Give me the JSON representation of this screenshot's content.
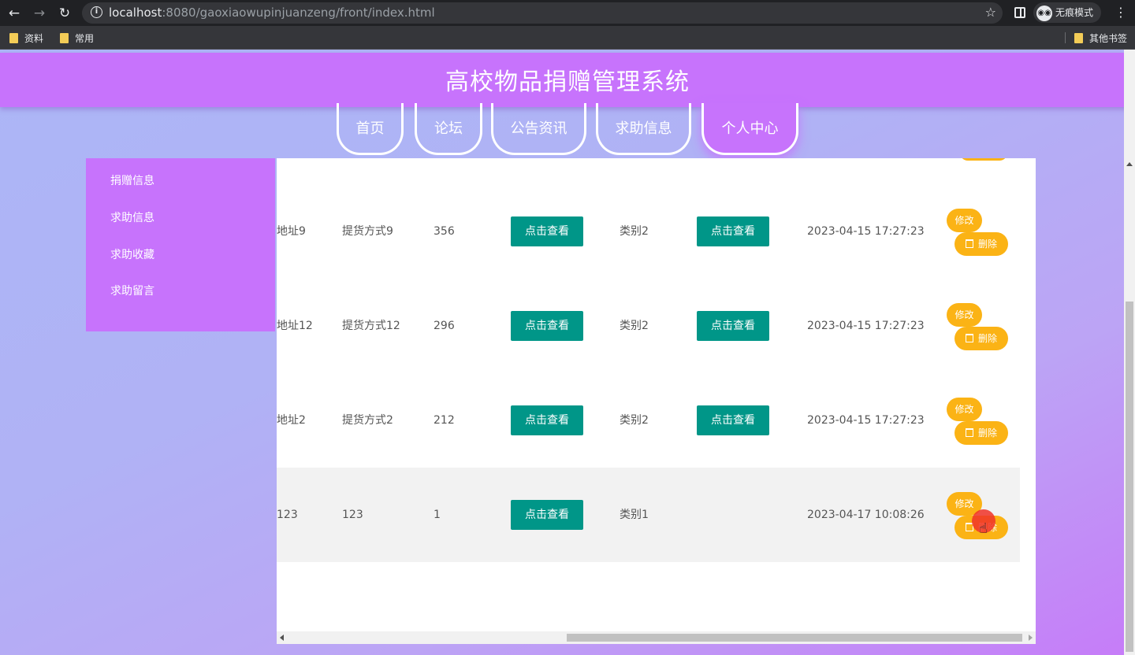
{
  "browser": {
    "url_host": "localhost",
    "url_rest": ":8080/gaoxiaowupinjuanzeng/front/index.html",
    "incognito_label": "无痕模式",
    "bookmarks": [
      "资料",
      "常用"
    ],
    "other_bookmarks": "其他书签"
  },
  "site": {
    "title": "高校物品捐赠管理系统",
    "nav": [
      "首页",
      "论坛",
      "公告资讯",
      "求助信息",
      "个人中心"
    ],
    "active_nav": "个人中心"
  },
  "sidebar": {
    "items": [
      "捐赠信息",
      "求助信息",
      "求助收藏",
      "求助留言"
    ]
  },
  "table": {
    "view_label": "点击查看",
    "edit_label": "修改",
    "delete_label": "删除",
    "rows": [
      {
        "address": "地址9",
        "pickup": "提货方式9",
        "qty": "356",
        "category": "类别2",
        "has_second_view": true,
        "time": "2023-04-15 17:27:23"
      },
      {
        "address": "地址12",
        "pickup": "提货方式12",
        "qty": "296",
        "category": "类别2",
        "has_second_view": true,
        "time": "2023-04-15 17:27:23"
      },
      {
        "address": "地址2",
        "pickup": "提货方式2",
        "qty": "212",
        "category": "类别2",
        "has_second_view": true,
        "time": "2023-04-15 17:27:23"
      },
      {
        "address": "123",
        "pickup": "123",
        "qty": "1",
        "category": "类别1",
        "has_second_view": false,
        "time": "2023-04-17 10:08:26"
      }
    ]
  },
  "colors": {
    "primary": "#c773fc",
    "view_button": "#009688",
    "action_button": "#fbb315"
  }
}
